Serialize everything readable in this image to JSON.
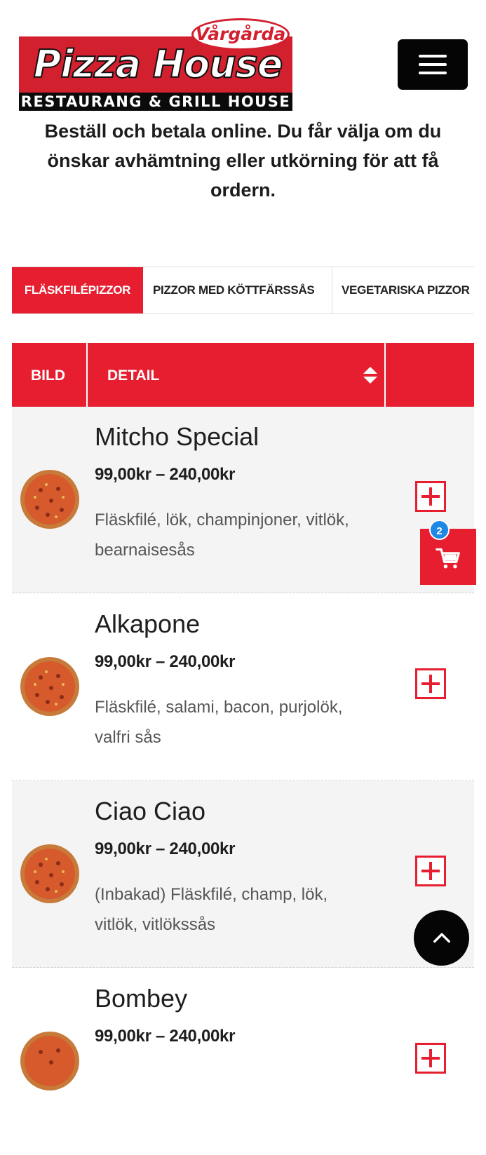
{
  "header": {
    "logo": {
      "brand_text": "Pizza House",
      "town_text": "Vårgårda",
      "tagline": "RESTAURANG & GRILL HOUSE"
    },
    "menu_icon": "hamburger-icon"
  },
  "intro_text": "Beställ och betala online. Du får välja om du önskar avhämtning eller utkörning för att få ordern.",
  "tabs": [
    {
      "label": "FLÄSKFILÉPIZZOR",
      "active": true
    },
    {
      "label": "PIZZOR MED KÖTTFÄRSSÅS",
      "active": false
    },
    {
      "label": "VEGETARISKA PIZZOR",
      "active": false
    }
  ],
  "table": {
    "columns": {
      "image": "BILD",
      "detail": "DETAIL",
      "action": ""
    },
    "sort_icon": "sort-icon"
  },
  "products": [
    {
      "name": "Mitcho Special",
      "price": "99,00kr – 240,00kr",
      "description": "Fläskfilé, lök, champinjoner, vitlök, bearnaisesås"
    },
    {
      "name": "Alkapone",
      "price": "99,00kr – 240,00kr",
      "description": "Fläskfilé, salami, bacon, purjolök, valfri sås"
    },
    {
      "name": "Ciao Ciao",
      "price": "99,00kr – 240,00kr",
      "description": "(Inbakad) Fläskfilé, champ, lök, vitlök, vitlökssås"
    },
    {
      "name": "Bombey",
      "price": "99,00kr – 240,00kr",
      "description": ""
    }
  ],
  "cart": {
    "count": "2",
    "icon": "cart-icon"
  },
  "scroll_top_icon": "chevron-up-icon",
  "colors": {
    "accent": "#e61e30",
    "badge": "#1e88e5",
    "dark": "#050505"
  }
}
